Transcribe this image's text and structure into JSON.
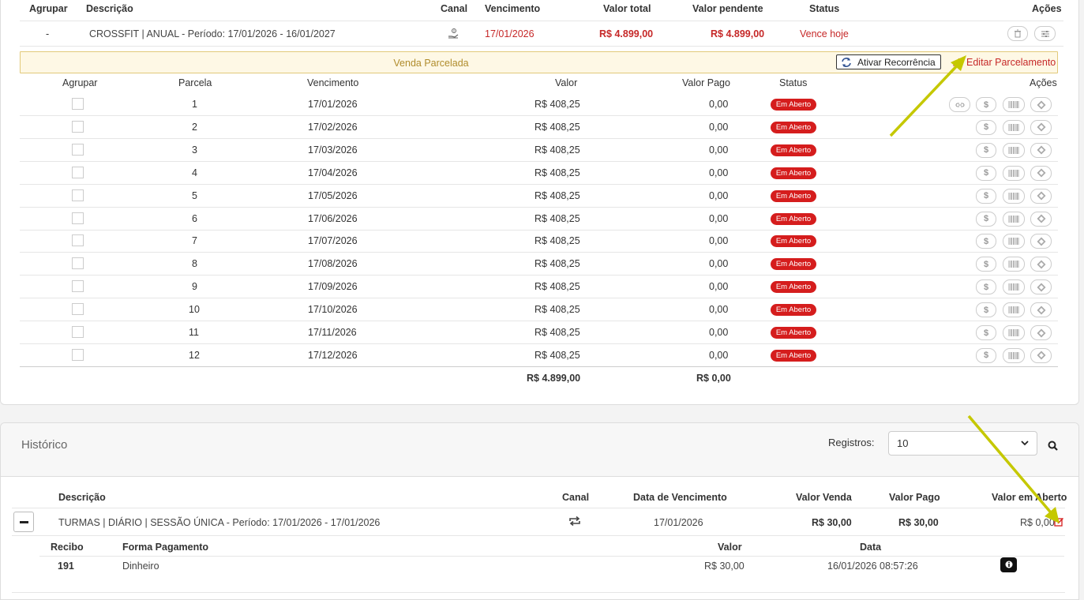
{
  "top_table": {
    "headers": {
      "agrupar": "Agrupar",
      "descricao": "Descrição",
      "canal": "Canal",
      "vencimento": "Vencimento",
      "valor_total": "Valor total",
      "valor_pendente": "Valor pendente",
      "status": "Status",
      "acoes": "Ações"
    },
    "row": {
      "agrupar": "-",
      "descricao": "CROSSFIT | ANUAL  - Período: 17/01/2026 - 16/01/2027",
      "canal_icon": "hand-money-icon",
      "vencimento": "17/01/2026",
      "valor_total": "R$ 4.899,00",
      "valor_pendente": "R$ 4.899,00",
      "status": "Vence hoje"
    }
  },
  "banner": {
    "title": "Venda Parcelada",
    "recorrencia_label": "Ativar Recorrência",
    "editar_label": "Editar Parcelamento"
  },
  "installments": {
    "headers": {
      "agrupar": "Agrupar",
      "parcela": "Parcela",
      "vencimento": "Vencimento",
      "valor": "Valor",
      "valor_pago": "Valor Pago",
      "status": "Status",
      "acoes": "Ações"
    },
    "rows": [
      {
        "parcela": "1",
        "vencimento": "17/01/2026",
        "valor": "R$ 408,25",
        "valor_pago": "0,00",
        "status": "Em Aberto"
      },
      {
        "parcela": "2",
        "vencimento": "17/02/2026",
        "valor": "R$ 408,25",
        "valor_pago": "0,00",
        "status": "Em Aberto"
      },
      {
        "parcela": "3",
        "vencimento": "17/03/2026",
        "valor": "R$ 408,25",
        "valor_pago": "0,00",
        "status": "Em Aberto"
      },
      {
        "parcela": "4",
        "vencimento": "17/04/2026",
        "valor": "R$ 408,25",
        "valor_pago": "0,00",
        "status": "Em Aberto"
      },
      {
        "parcela": "5",
        "vencimento": "17/05/2026",
        "valor": "R$ 408,25",
        "valor_pago": "0,00",
        "status": "Em Aberto"
      },
      {
        "parcela": "6",
        "vencimento": "17/06/2026",
        "valor": "R$ 408,25",
        "valor_pago": "0,00",
        "status": "Em Aberto"
      },
      {
        "parcela": "7",
        "vencimento": "17/07/2026",
        "valor": "R$ 408,25",
        "valor_pago": "0,00",
        "status": "Em Aberto"
      },
      {
        "parcela": "8",
        "vencimento": "17/08/2026",
        "valor": "R$ 408,25",
        "valor_pago": "0,00",
        "status": "Em Aberto"
      },
      {
        "parcela": "9",
        "vencimento": "17/09/2026",
        "valor": "R$ 408,25",
        "valor_pago": "0,00",
        "status": "Em Aberto"
      },
      {
        "parcela": "10",
        "vencimento": "17/10/2026",
        "valor": "R$ 408,25",
        "valor_pago": "0,00",
        "status": "Em Aberto"
      },
      {
        "parcela": "11",
        "vencimento": "17/11/2026",
        "valor": "R$ 408,25",
        "valor_pago": "0,00",
        "status": "Em Aberto"
      },
      {
        "parcela": "12",
        "vencimento": "17/12/2026",
        "valor": "R$ 408,25",
        "valor_pago": "0,00",
        "status": "Em Aberto"
      }
    ],
    "total_valor": "R$ 4.899,00",
    "total_pago": "R$ 0,00"
  },
  "historico": {
    "title": "Histórico",
    "registros_label": "Registros:",
    "registros_value": "10",
    "headers": {
      "descricao": "Descrição",
      "canal": "Canal",
      "data_vencimento": "Data de Vencimento",
      "valor_venda": "Valor Venda",
      "valor_pago": "Valor Pago",
      "valor_aberto": "Valor em Aberto"
    },
    "row": {
      "descricao": "TURMAS | DIÁRIO | SESSÃO ÚNICA - Período: 17/01/2026 - 17/01/2026",
      "data_vencimento": "17/01/2026",
      "valor_venda": "R$ 30,00",
      "valor_pago": "R$ 30,00",
      "valor_aberto": "R$ 0,00"
    },
    "sub_headers": {
      "recibo": "Recibo",
      "forma": "Forma Pagamento",
      "valor": "Valor",
      "data": "Data"
    },
    "sub_row": {
      "recibo": "191",
      "forma": "Dinheiro",
      "valor": "R$ 30,00",
      "data": "16/01/2026 08:57:26"
    }
  },
  "colors": {
    "accent_red": "#c62828",
    "badge_red": "#d51d1d",
    "banner_bg": "#fef8e5",
    "annotation_arrow": "#c5c800"
  }
}
